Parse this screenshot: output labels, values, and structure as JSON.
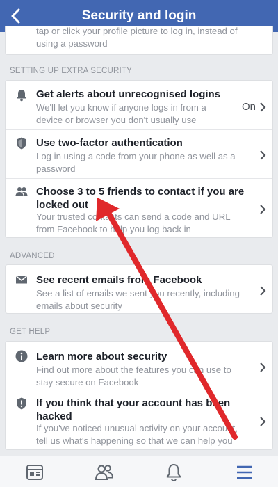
{
  "header": {
    "title": "Security and login"
  },
  "top_card": {
    "partial_text": "tap or click your profile picture to log in, instead of\nusing a password"
  },
  "sections": {
    "extra_security": {
      "header": "SETTING UP EXTRA SECURITY",
      "rows": [
        {
          "title": "Get alerts about unrecognised logins",
          "desc": "We'll let you know if anyone logs in from a device or browser you don't usually use",
          "status": "On",
          "icon": "bell-icon"
        },
        {
          "title": "Use two-factor authentication",
          "desc": "Log in using a code from your phone as well as a password",
          "icon": "shield-icon"
        },
        {
          "title": "Choose 3 to 5 friends to contact if you are locked out",
          "desc": "Your trusted contacts can send a code and URL from Facebook to help you log back in",
          "icon": "friends-icon"
        }
      ]
    },
    "advanced": {
      "header": "ADVANCED",
      "rows": [
        {
          "title": "See recent emails from Facebook",
          "desc": "See a list of emails we sent you recently, including emails about security",
          "icon": "envelope-icon"
        }
      ]
    },
    "get_help": {
      "header": "GET HELP",
      "rows": [
        {
          "title": "Learn more about security",
          "desc": "Find out more about the features you can use to stay secure on Facebook",
          "icon": "info-icon"
        },
        {
          "title": "If you think that your account has been hacked",
          "desc": "If you've noticed unusual activity on your account, tell us what's happening so that we can help you",
          "icon": "shield-alert-icon"
        }
      ]
    }
  },
  "tab_bar": {
    "tabs": [
      "news-feed-icon",
      "friends-tab-icon",
      "notifications-bell-icon",
      "menu-icon"
    ],
    "active": "menu-icon"
  },
  "colors": {
    "brand_blue": "#4267b2",
    "arrow_red": "#e0282b",
    "active_tab": "#4267b2",
    "muted_text": "#90949c"
  }
}
